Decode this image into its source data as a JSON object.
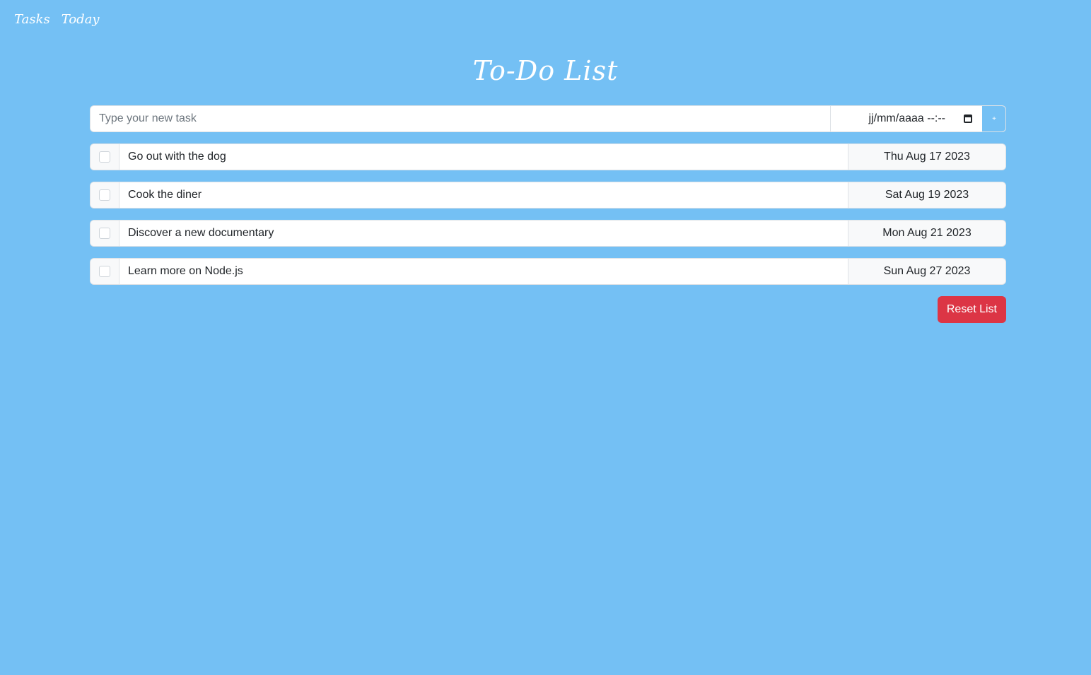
{
  "nav": {
    "items": [
      {
        "label": "Tasks"
      },
      {
        "label": "Today"
      }
    ]
  },
  "page": {
    "title": "To-Do List"
  },
  "new_task": {
    "placeholder": "Type your new task",
    "date_placeholder": "jj/mm/aaaa --:--",
    "add_label": "+"
  },
  "tasks": [
    {
      "text": "Go out with the dog",
      "date": "Thu Aug 17 2023",
      "checked": false
    },
    {
      "text": "Cook the diner",
      "date": "Sat Aug 19 2023",
      "checked": false
    },
    {
      "text": "Discover a new documentary",
      "date": "Mon Aug 21 2023",
      "checked": false
    },
    {
      "text": "Learn more on Node.js",
      "date": "Sun Aug 27 2023",
      "checked": false
    }
  ],
  "actions": {
    "reset_label": "Reset List"
  },
  "colors": {
    "background": "#74c0f4",
    "danger": "#dc3545"
  }
}
